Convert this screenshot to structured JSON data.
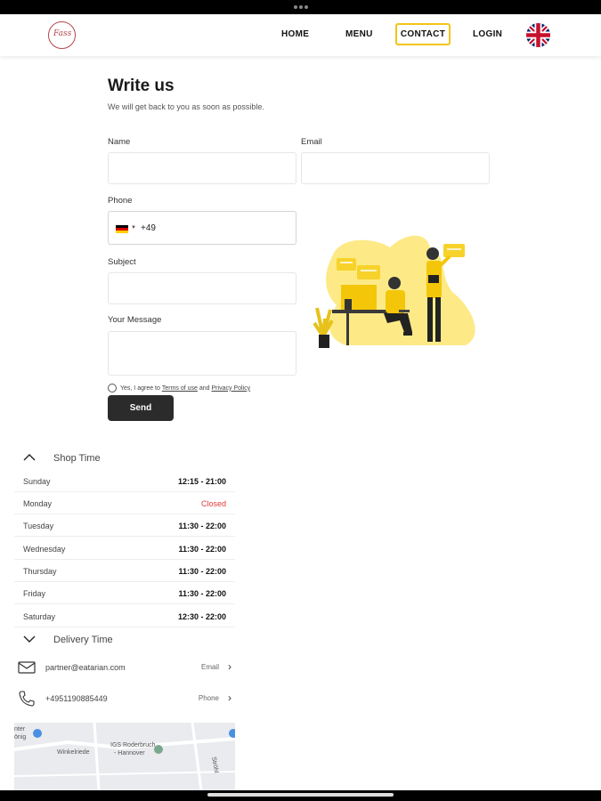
{
  "nav": {
    "logo_text": "Fass",
    "home": "HOME",
    "menu": "MENU",
    "contact": "CONTACT",
    "login": "LOGIN",
    "language_icon": "uk-flag-icon"
  },
  "form": {
    "title": "Write us",
    "subtitle": "We will get back to you as soon as possible.",
    "name_label": "Name",
    "email_label": "Email",
    "phone_label": "Phone",
    "phone_code": "+49",
    "phone_country_icon": "germany-flag-icon",
    "subject_label": "Subject",
    "message_label": "Your Message",
    "consent_prefix": "Yes, I agree to",
    "terms_link": "Terms of use",
    "consent_and": "and",
    "privacy_link": "Privacy Policy",
    "send_label": "Send"
  },
  "shop_time": {
    "heading": "Shop Time",
    "days": [
      {
        "day": "Sunday",
        "time": "12:15 - 21:00",
        "closed": false
      },
      {
        "day": "Monday",
        "time": "Closed",
        "closed": true
      },
      {
        "day": "Tuesday",
        "time": "11:30 - 22:00",
        "closed": false
      },
      {
        "day": "Wednesday",
        "time": "11:30 - 22:00",
        "closed": false
      },
      {
        "day": "Thursday",
        "time": "11:30 - 22:00",
        "closed": false
      },
      {
        "day": "Friday",
        "time": "11:30 - 22:00",
        "closed": false
      },
      {
        "day": "Saturday",
        "time": "12:30 - 22:00",
        "closed": false
      }
    ]
  },
  "delivery_time": {
    "heading": "Delivery Time"
  },
  "contacts": {
    "email_value": "partner@eatarian.com",
    "email_action": "Email",
    "phone_value": "+4951190885449",
    "phone_action": "Phone"
  },
  "map": {
    "label_1": "Winkelriede",
    "label_2": "IGS Roderbruch",
    "label_3": "- Hannover",
    "label_4": "nter",
    "label_5": "önig",
    "label_6": "Ströhl"
  },
  "colors": {
    "accent": "#f2c418",
    "closed": "#e23a3a",
    "button": "#2b2b2b"
  }
}
